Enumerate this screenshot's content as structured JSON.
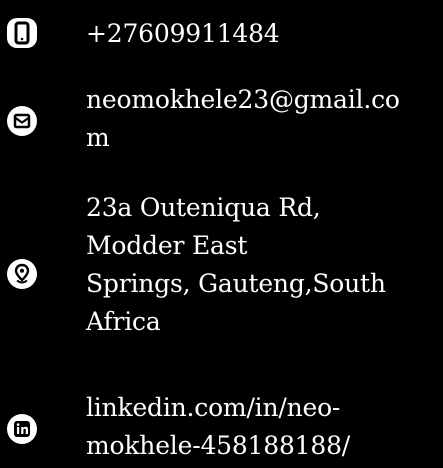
{
  "contacts": {
    "phone": {
      "icon": "phone-icon",
      "text": "+27609911484"
    },
    "email": {
      "icon": "envelope-icon",
      "line1": "neomokhele23@gmail.co",
      "line2": "m"
    },
    "address": {
      "icon": "map-pin-icon",
      "line1": "23a Outeniqua Rd,",
      "line2": "Modder East",
      "line3": "Springs, Gauteng,South",
      "line4": "Africa"
    },
    "linkedin": {
      "icon": "linkedin-icon",
      "line1": "linkedin.com/in/neo-",
      "line2": "mokhele-458188188/"
    }
  },
  "colors": {
    "background": "#000000",
    "text": "#ffffff",
    "icon_bg": "#ffffff",
    "icon_fg": "#000000"
  }
}
